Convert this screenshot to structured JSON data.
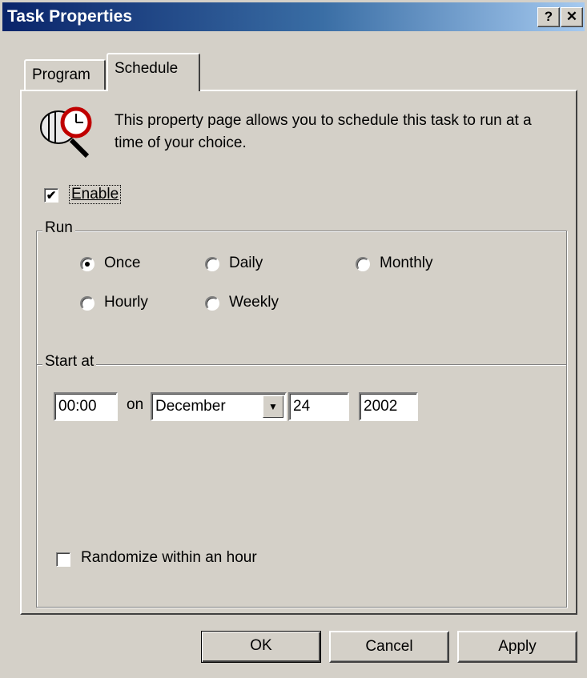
{
  "window": {
    "title": "Task Properties",
    "help_label": "?",
    "close_label": "✕"
  },
  "tabs": [
    {
      "label": "Program",
      "active": false
    },
    {
      "label": "Schedule",
      "active": true
    }
  ],
  "description": "This property page allows you to schedule this task to run at a time of your choice.",
  "enable": {
    "label": "Enable",
    "checked": true,
    "check_glyph": "✔"
  },
  "run": {
    "legend": "Run",
    "options": [
      {
        "label": "Once",
        "selected": true
      },
      {
        "label": "Daily",
        "selected": false
      },
      {
        "label": "Monthly",
        "selected": false
      },
      {
        "label": "Hourly",
        "selected": false
      },
      {
        "label": "Weekly",
        "selected": false
      }
    ]
  },
  "start_at": {
    "legend": "Start at",
    "time": "00:00",
    "on_label": "on",
    "month": "December",
    "day": "24",
    "year": "2002",
    "dropdown_glyph": "▼"
  },
  "randomize": {
    "label": "Randomize within an hour",
    "checked": false
  },
  "buttons": {
    "ok": "OK",
    "cancel": "Cancel",
    "apply": "Apply"
  },
  "icons": {
    "schedule": "clock-magnifier-icon"
  }
}
